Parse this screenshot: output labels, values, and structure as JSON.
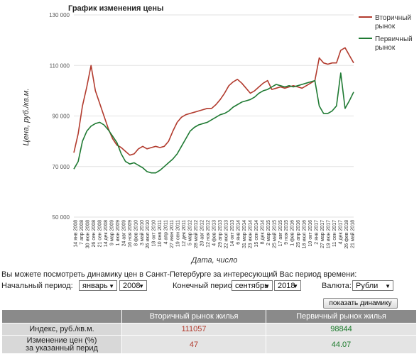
{
  "chart_data": {
    "type": "line",
    "title": "График изменения цены",
    "xlabel": "Дата, число",
    "ylabel": "Цена, руб./кв.м.",
    "ylim": [
      50000,
      130000
    ],
    "y_ticks": [
      "130 000",
      "110 000",
      "90 000",
      "70 000",
      "50 000"
    ],
    "x_ticks": [
      "14 янв 2008",
      "7 апр 2008",
      "30 июн 2008",
      "26 сен 2008",
      "21 сен 2008",
      "14 дек 2008",
      "9 мар 2009",
      "1 июн 2009",
      "24 авг 2009",
      "16 ноя 2009",
      "8 фев 2010",
      "3 май 2010",
      "26 июл 2010",
      "18 окт 2010",
      "10 янв 2011",
      "4 апр 2011",
      "27 июн 2011",
      "19 сен 2011",
      "12 дек 2011",
      "5 мар 2012",
      "28 май 2012",
      "20 авг 2012",
      "12 ноя 2012",
      "4 фев 2013",
      "29 апр 2013",
      "22 июл 2013",
      "14 окт 2013",
      "6 янв 2014",
      "31 мар 2014",
      "23 июн 2014",
      "15 сен 2014",
      "8 дек 2014",
      "2 мар 2015",
      "25 май 2015",
      "17 авг 2015",
      "9 ноя 2015",
      "1 фев 2016",
      "25 апр 2016",
      "18 июл 2016",
      "10 окт 2016",
      "2 янв 2017",
      "27 мар 2017",
      "19 июн 2017",
      "11 сен 2017",
      "4 дек 2017",
      "26 фев 2018",
      "21 май 2018"
    ],
    "legend_position": "top-right",
    "series": [
      {
        "name": "Вторичный рынок",
        "color": "#b23b2e",
        "values": [
          75500,
          83000,
          94000,
          101500,
          110000,
          100000,
          95000,
          90000,
          85000,
          81000,
          78500,
          77500,
          76000,
          74500,
          75000,
          77000,
          78000,
          77000,
          77500,
          78000,
          77500,
          78000,
          80000,
          84000,
          87500,
          89500,
          90500,
          91000,
          91500,
          92000,
          92500,
          93000,
          93000,
          94500,
          96500,
          99000,
          102000,
          103500,
          104500,
          103000,
          101000,
          99000,
          100000,
          101500,
          103000,
          104000,
          100500,
          101000,
          101500,
          101000,
          101500,
          102000,
          101500,
          101000,
          102000,
          103000,
          104000,
          113000,
          111000,
          110500,
          111000,
          111000,
          116000,
          117000,
          114000,
          111000
        ]
      },
      {
        "name": "Первичный рынок",
        "color": "#1f7a33",
        "values": [
          69000,
          72000,
          80000,
          84000,
          86000,
          87000,
          87500,
          86500,
          84500,
          82000,
          79500,
          75000,
          72000,
          71000,
          71500,
          70500,
          69500,
          68000,
          67500,
          67500,
          68500,
          70000,
          71500,
          73000,
          75000,
          78000,
          81000,
          84000,
          85500,
          86500,
          87000,
          87500,
          88500,
          89500,
          90500,
          91000,
          92000,
          93500,
          94500,
          95500,
          96000,
          96500,
          97500,
          99000,
          100000,
          100500,
          101500,
          102500,
          102000,
          101500,
          102000,
          101500,
          102000,
          102500,
          103000,
          103500,
          104000,
          94000,
          91000,
          91000,
          92000,
          94000,
          107000,
          93000,
          96000,
          99500
        ]
      }
    ]
  },
  "controls": {
    "prompt": "Вы можете посмотреть динамику цен в Санкт-Петербурге за интересующий Вас период времени:",
    "start_label": "Начальный период:",
    "start_month": "январь",
    "start_year": "2008",
    "end_label": "Конечный период:",
    "end_month": "сентябрь",
    "end_year": "2018",
    "currency_label": "Валюта:",
    "currency": "Рубли",
    "show_button": "показать динамику цен"
  },
  "table": {
    "headers": [
      "",
      "Вторичный рынок жилья",
      "Первичный рынок жилья"
    ],
    "rows": [
      {
        "label": "Индекс, руб./кв.м.",
        "secondary": "111057",
        "primary": "98844"
      },
      {
        "label": "Изменение цен (%)\nза указанный перид",
        "secondary": "47",
        "primary": "44.07"
      }
    ]
  }
}
